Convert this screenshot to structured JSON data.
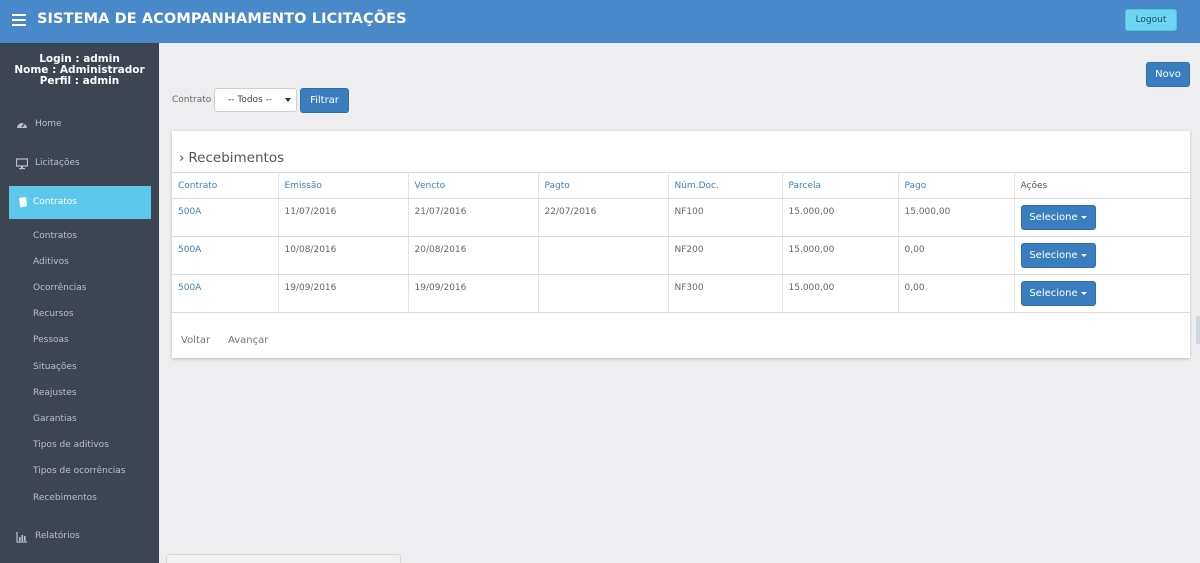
{
  "header": {
    "title": "SISTEMA DE ACOMPANHAMENTO LICITAÇÕES",
    "logout_label": "Logout",
    "menu_icon": "hamburger-icon"
  },
  "user": {
    "login": "Login : admin",
    "nome": "Nome : Administrador",
    "perfil": "Perfil : admin"
  },
  "sidebar": {
    "main": [
      {
        "label": "Home",
        "icon": "tachometer-icon"
      },
      {
        "label": "Licitações",
        "icon": "monitor-icon"
      },
      {
        "label": "Contratos",
        "icon": "book-icon",
        "active": true
      },
      {
        "label": "Relatórios",
        "icon": "bar-chart-icon"
      }
    ],
    "sub": [
      "Contratos",
      "Aditivos",
      "Ocorrências",
      "Recursos",
      "Pessoas",
      "Situações",
      "Reajustes",
      "Garantias",
      "Tipos de aditivos",
      "Tipos de ocorrências",
      "Recebimentos"
    ]
  },
  "toolbar": {
    "novo_label": "Novo",
    "contrato_label": "Contrato",
    "contrato_selected": "-- Todos --",
    "filtrar_label": "Filtrar"
  },
  "panel": {
    "title": "Recebimentos",
    "columns": [
      "Contrato",
      "Emissão",
      "Vencto",
      "Pagto",
      "Núm.Doc.",
      "Parcela",
      "Pago",
      "Ações"
    ],
    "rows": [
      {
        "contrato": "500A",
        "emissao": "11/07/2016",
        "vencto": "21/07/2016",
        "pagto": "22/07/2016",
        "numdoc": "NF100",
        "parcela": "15.000,00",
        "pago": "15.000,00",
        "acao": "Selecione"
      },
      {
        "contrato": "500A",
        "emissao": "10/08/2016",
        "vencto": "20/08/2016",
        "pagto": "",
        "numdoc": "NF200",
        "parcela": "15.000,00",
        "pago": "0,00",
        "acao": "Selecione"
      },
      {
        "contrato": "500A",
        "emissao": "19/09/2016",
        "vencto": "19/09/2016",
        "pagto": "",
        "numdoc": "NF300",
        "parcela": "15.000,00",
        "pago": "0,00",
        "acao": "Selecione"
      }
    ],
    "pager": {
      "prev": "Voltar",
      "next": "Avançar"
    }
  },
  "colors": {
    "header_bg": "#4a89c9",
    "sidebar_bg": "#3d4552",
    "active_item": "#5bc8ec",
    "primary_button": "#3b7ec0",
    "logout_button": "#6dd6f0",
    "link": "#3f7fbf"
  }
}
